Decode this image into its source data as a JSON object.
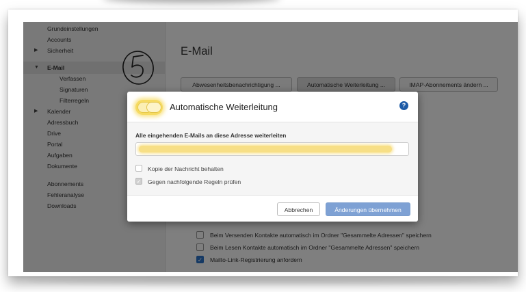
{
  "sidebar": {
    "items": [
      {
        "label": "Grundeinstellungen"
      },
      {
        "label": "Accounts"
      },
      {
        "label": "Sicherheit"
      },
      {
        "label": "E-Mail"
      },
      {
        "label": "Verfassen"
      },
      {
        "label": "Signaturen"
      },
      {
        "label": "Filterregeln"
      },
      {
        "label": "Kalender"
      },
      {
        "label": "Adressbuch"
      },
      {
        "label": "Drive"
      },
      {
        "label": "Portal"
      },
      {
        "label": "Aufgaben"
      },
      {
        "label": "Dokumente"
      },
      {
        "label": "Abonnements"
      },
      {
        "label": "Fehleranalyse"
      },
      {
        "label": "Downloads"
      }
    ]
  },
  "main": {
    "title": "E-Mail",
    "buttons": {
      "vacation": "Abwesenheitsbenachrichtigung ...",
      "autoforward": "Automatische Weiterleitung ...",
      "imap": "IMAP-Abonnements ändern ..."
    },
    "checkboxes": [
      {
        "label": "Beim Versenden Kontakte automatisch im Ordner \"Gesammelte Adressen\" speichern",
        "checked": false
      },
      {
        "label": "Beim Lesen Kontakte automatisch im Ordner \"Gesammelte Adressen\" speichern",
        "checked": false
      },
      {
        "label": "Mailto-Link-Registrierung anfordern",
        "checked": true
      }
    ]
  },
  "annotation": {
    "number": "5"
  },
  "modal": {
    "title": "Automatische Weiterleitung",
    "help_icon": "?",
    "field_label": "Alle eingehenden E-Mails an diese Adresse weiterleiten",
    "keep_copy": {
      "label": "Kopie der Nachricht behalten",
      "checked": false
    },
    "check_rules": {
      "label": "Gegen nachfolgende Regeln prüfen",
      "checked": true
    },
    "cancel_label": "Abbrechen",
    "apply_label": "Änderungen übernehmen",
    "colors": {
      "primary": "#7ea1d4",
      "highlight": "#f6db63"
    }
  }
}
